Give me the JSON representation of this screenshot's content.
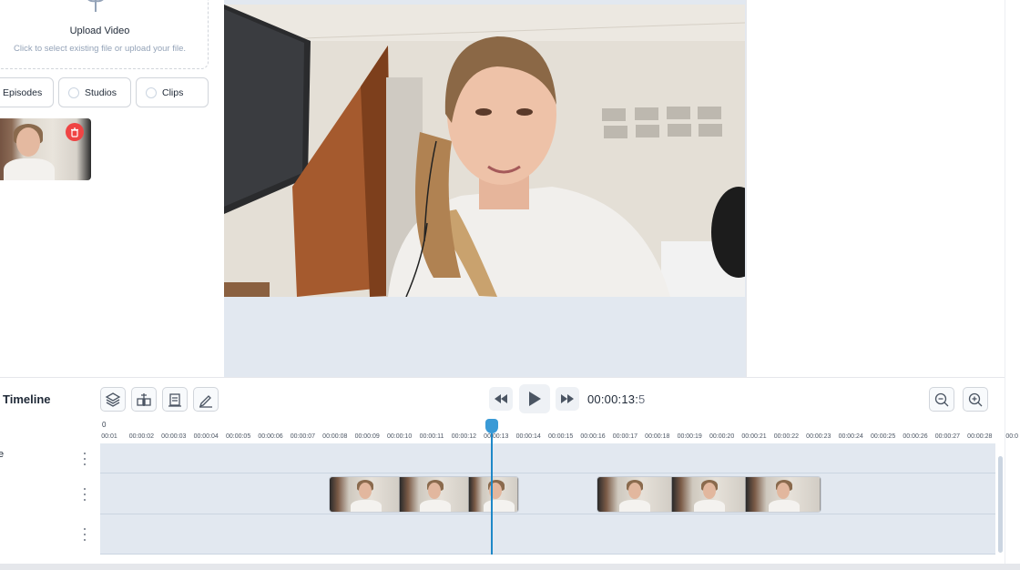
{
  "upload": {
    "title": "Upload Video",
    "subtitle": "Click to select existing file or upload your file."
  },
  "filters": [
    {
      "label": "Episodes",
      "radio": false
    },
    {
      "label": "Studios",
      "radio": true
    },
    {
      "label": "Clips",
      "radio": true
    }
  ],
  "timeline": {
    "title": "Timeline",
    "timecode_main": "00:00:13:",
    "timecode_sub": "5",
    "ruler_zero": "0",
    "ticks": [
      "00:01",
      "00:00:02",
      "00:00:03",
      "00:00:04",
      "00:00:05",
      "00:00:06",
      "00:00:07",
      "00:00:08",
      "00:00:09",
      "00:00:10",
      "00:00:11",
      "00:00:12",
      "00:00:13",
      "00:00:14",
      "00:00:15",
      "00:00:16",
      "00:00:17",
      "00:00:18",
      "00:00:19",
      "00:00:20",
      "00:00:21",
      "00:00:22",
      "00:00:23",
      "00:00:24",
      "00:00:25",
      "00:00:26",
      "00:00:27",
      "00:00:28",
      "00:0"
    ],
    "tracks": [
      {
        "label": "e"
      },
      {
        "label": ""
      },
      {
        "label": ""
      }
    ]
  },
  "colors": {
    "accent": "#1e88c8",
    "delete": "#ef4444",
    "track_bg": "#e2e8f0"
  },
  "icons": {
    "tools": [
      "layers-icon",
      "split-icon",
      "detach-audio-icon",
      "edit-icon"
    ],
    "controls": [
      "rewind-icon",
      "play-icon",
      "fast-forward-icon"
    ],
    "zoom": [
      "zoom-out-icon",
      "zoom-in-icon"
    ]
  }
}
